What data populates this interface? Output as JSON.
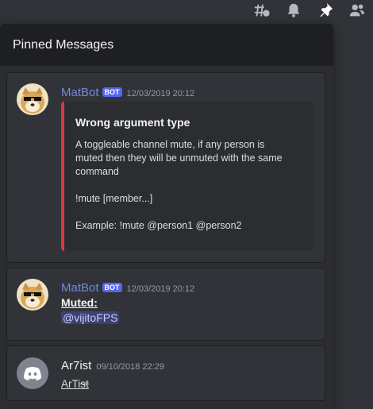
{
  "toolbar": {
    "icons": [
      "threads-icon",
      "notification-bell-icon",
      "pinned-messages-icon",
      "member-list-icon"
    ]
  },
  "pinned": {
    "title": "Pinned Messages"
  },
  "messages": [
    {
      "author": "MatBot",
      "badge": "BOT",
      "timestamp": "12/03/2019 20:12",
      "embed": {
        "title": "Wrong argument type",
        "description_line1": "A toggleable channel mute, if any person is",
        "description_line2": "muted then they will be unmuted with the same",
        "description_line3": "command",
        "usage": "!mute [member...]",
        "example": "Example: !mute @person1 @person2",
        "color": "#da373c"
      }
    },
    {
      "author": "MatBot",
      "badge": "BOT",
      "timestamp": "12/03/2019 20:12",
      "content_title": "Muted:",
      "mention": "@vijitoFPS"
    },
    {
      "author": "Ar7ist",
      "timestamp": "09/10/2018 22:29",
      "content_prefix": "ArTi",
      "content_strike": "st"
    }
  ],
  "colors": {
    "bot_name": "#7289da",
    "user_name": "#f2f3f5",
    "bot_badge": "#5865f2",
    "mention_bg": "#3c4270"
  }
}
